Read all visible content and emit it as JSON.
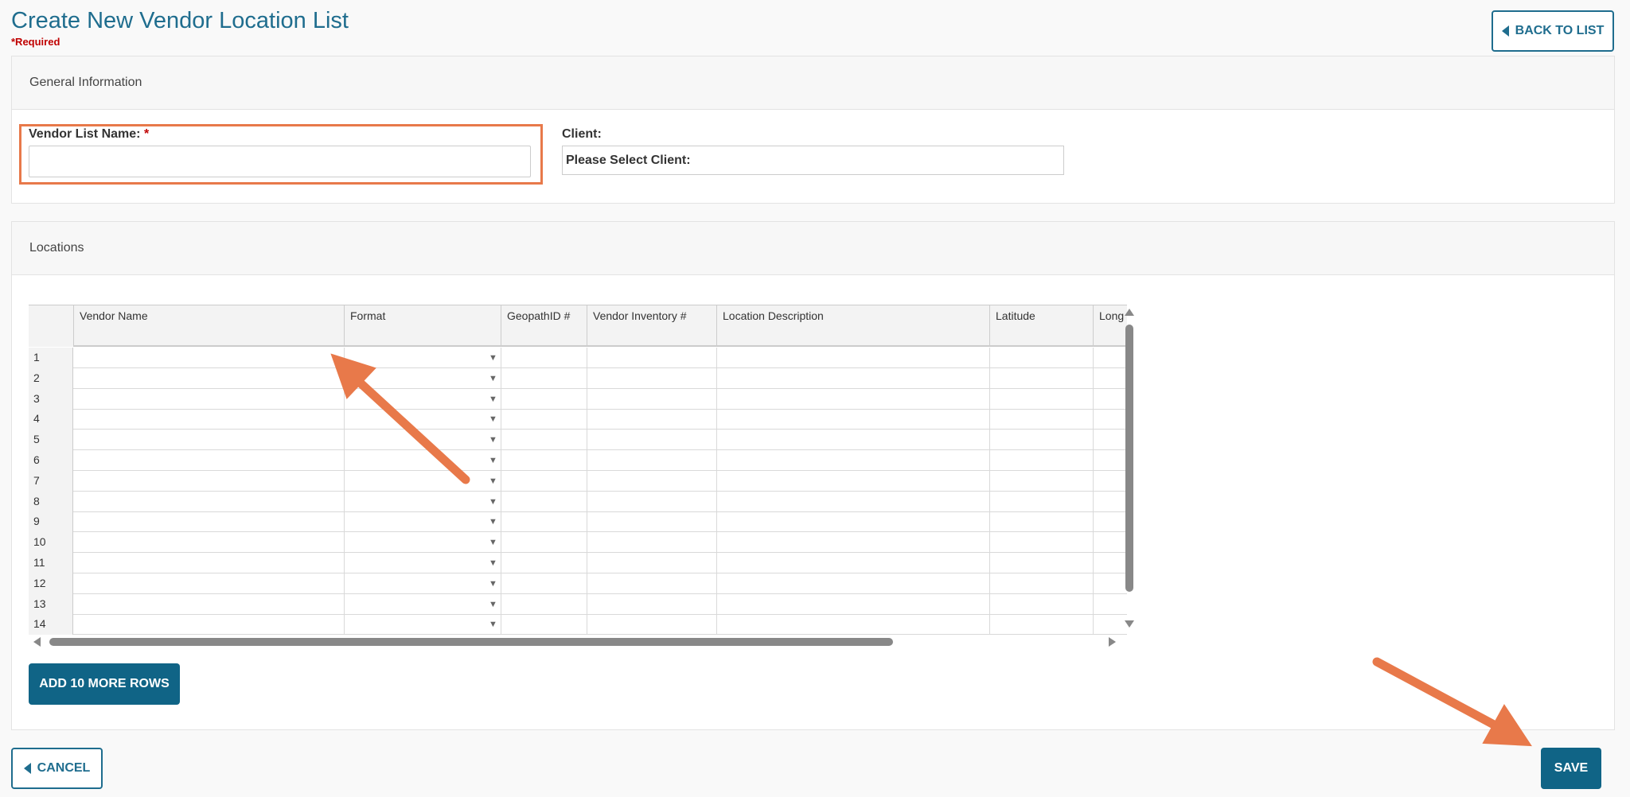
{
  "page": {
    "title": "Create New Vendor Location List",
    "required_note": "*Required",
    "back_label": "BACK TO LIST"
  },
  "general": {
    "section_title": "General Information",
    "vendor_list_name_label": "Vendor List Name:",
    "required_star": "*",
    "vendor_list_name_value": "",
    "client_label": "Client:",
    "client_selected": "Please Select Client:"
  },
  "locations": {
    "section_title": "Locations",
    "columns": [
      "Vendor Name",
      "Format",
      "GeopathID #",
      "Vendor Inventory #",
      "Location Description",
      "Latitude",
      "Long"
    ],
    "rows": [
      "1",
      "2",
      "3",
      "4",
      "5",
      "6",
      "7",
      "8",
      "9",
      "10",
      "11",
      "12",
      "13",
      "14"
    ],
    "add_rows_label": "ADD 10 MORE ROWS"
  },
  "footer": {
    "cancel_label": "CANCEL",
    "save_label": "SAVE"
  },
  "colors": {
    "accent": "#106486",
    "title": "#1f6d8e",
    "required": "#c00000",
    "annotation": "#e8794a"
  },
  "icons": [
    "chevron-left-icon",
    "dropdown-arrow-icon",
    "scroll-up-icon",
    "scroll-down-icon",
    "scroll-left-icon",
    "scroll-right-icon"
  ]
}
